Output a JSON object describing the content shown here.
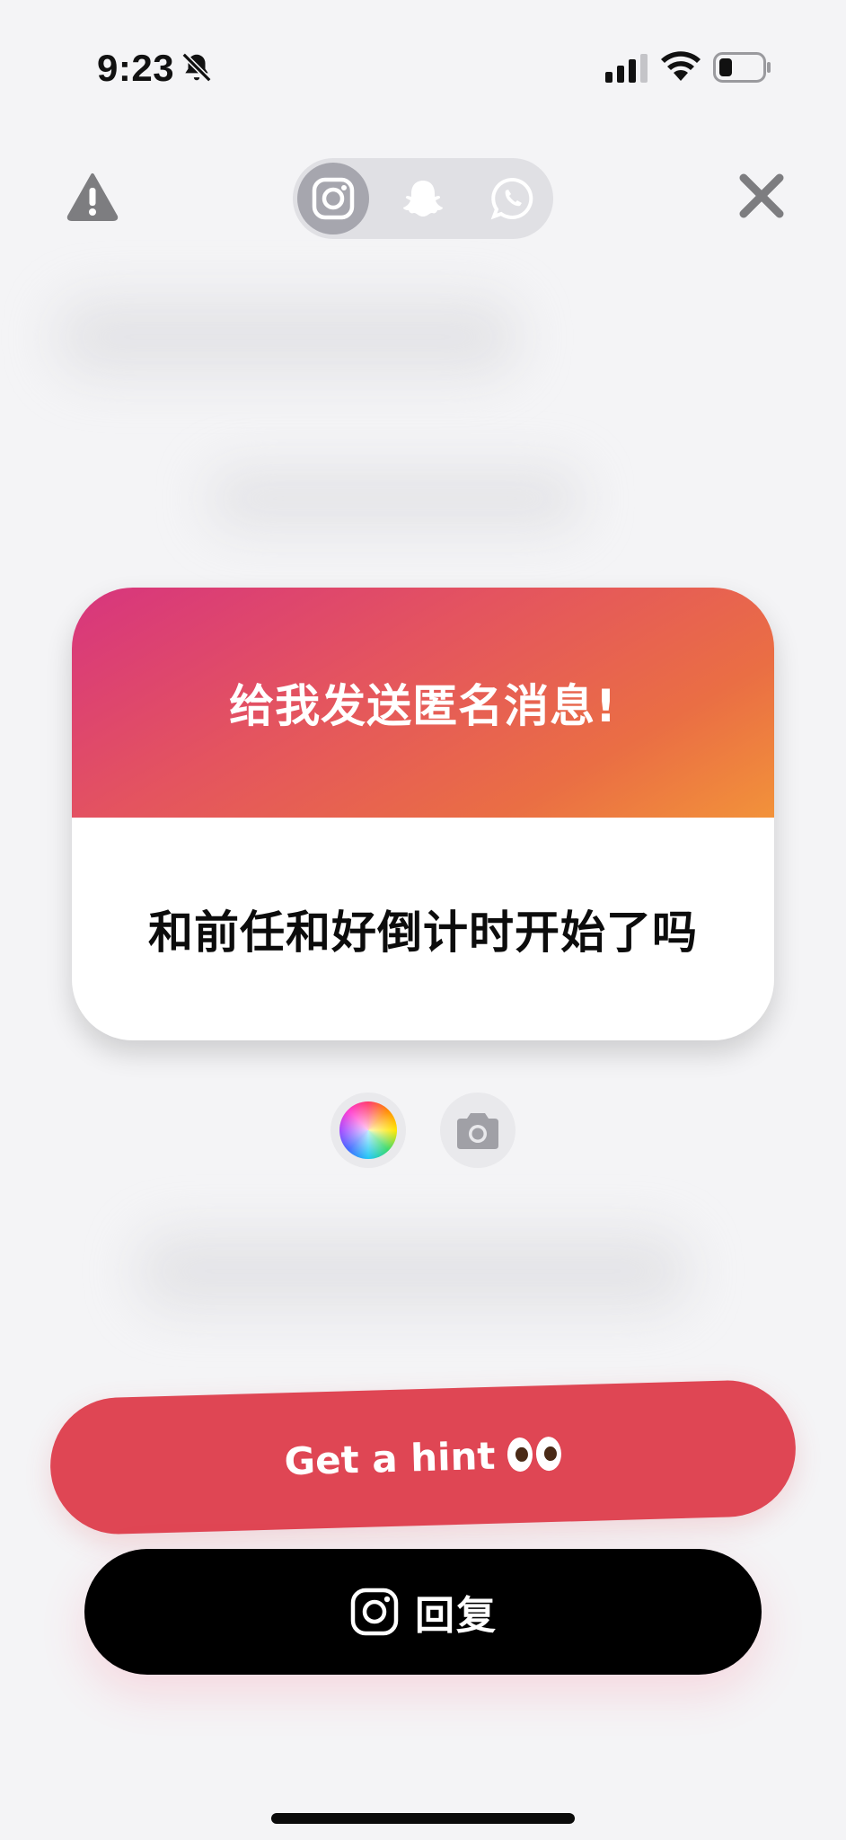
{
  "status_bar": {
    "time": "9:23",
    "icons": [
      "bell-slash-icon",
      "cellular-signal-icon",
      "wifi-icon",
      "battery-icon"
    ]
  },
  "top_bar": {
    "left_icon": "warning-icon",
    "right_icon": "close-icon",
    "platforms": [
      {
        "name": "instagram",
        "icon": "instagram-icon",
        "active": true
      },
      {
        "name": "snapchat",
        "icon": "snapchat-icon",
        "active": false
      },
      {
        "name": "whatsapp",
        "icon": "whatsapp-icon",
        "active": false
      }
    ]
  },
  "card": {
    "header_text": "给我发送匿名消息!",
    "message_text": "和前任和好倒计时开始了吗"
  },
  "tools": {
    "color_icon": "color-wheel-icon",
    "camera_icon": "camera-icon"
  },
  "actions": {
    "hint_label": "Get a hint",
    "hint_icon": "eyes-emoji-icon",
    "reply_label": "回复",
    "reply_icon": "instagram-icon"
  },
  "colors": {
    "hint_button": "#df4654",
    "reply_button": "#000000",
    "gradient_start": "#d7357e",
    "gradient_end": "#f2923a"
  }
}
